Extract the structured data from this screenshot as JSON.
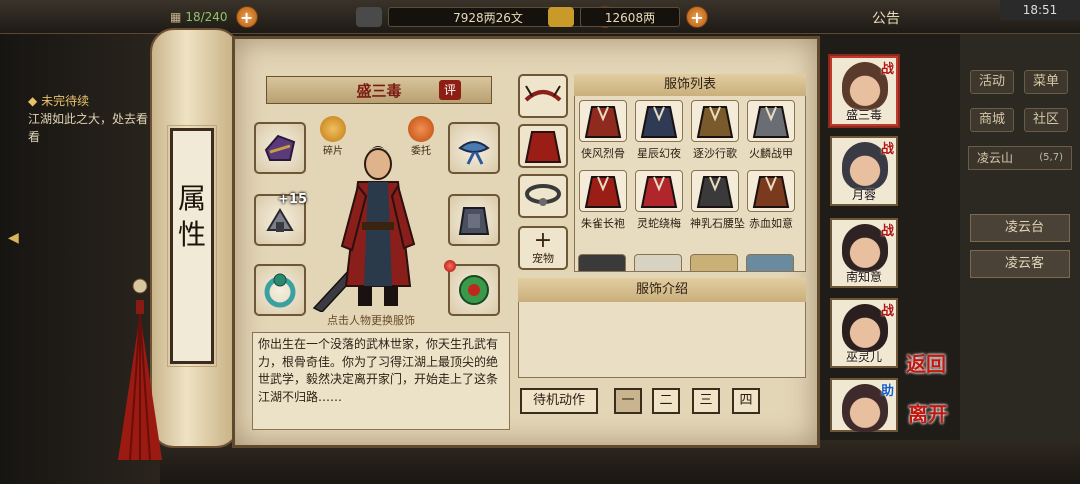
{
  "topbar": {
    "bag": "18/240",
    "silver": "7928两26文",
    "gold": "12608两",
    "notice": "公告",
    "time": "18:51"
  },
  "quest": {
    "title": "未完待续",
    "text": "江湖如此之大，处去看看"
  },
  "right_menu": {
    "activity": "活动",
    "menu": "菜单",
    "shop": "商城",
    "community": "社区",
    "area": "凌云山",
    "coords": "(5,7)",
    "places": [
      "凌云台",
      "凌云客"
    ]
  },
  "scroll": {
    "title": "属性"
  },
  "character": {
    "name": "盛三毒",
    "rate_label": "评",
    "bonus": "+15",
    "fragment_label": "碎片",
    "entrust_label": "委托",
    "hint": "点击人物更换服饰",
    "description": "你出生在一个没落的武林世家，你天生孔武有力，根骨奇佳。你为了习得江湖上最顶尖的绝世武学，毅然决定离开家门，开始走上了这条江湖不归路……"
  },
  "tabs": {
    "pet_label": "宠物"
  },
  "outfit_list": {
    "title": "服饰列表",
    "items": [
      {
        "name": "侠风烈骨",
        "color": "#8e2a1e"
      },
      {
        "name": "星辰幻夜",
        "color": "#2f3b55"
      },
      {
        "name": "逐沙行歌",
        "color": "#7a5a2a"
      },
      {
        "name": "火麟战甲",
        "color": "#6a6e74"
      },
      {
        "name": "朱雀长袍",
        "color": "#9a1e16"
      },
      {
        "name": "灵蛇绕梅",
        "color": "#b0262a"
      },
      {
        "name": "神乳石腰坠",
        "color": "#3a3a3a"
      },
      {
        "name": "赤血如意",
        "color": "#7a3a1e"
      }
    ]
  },
  "outfit_intro": {
    "title": "服饰介绍"
  },
  "idle": {
    "label": "待机动作",
    "options": [
      "一",
      "二",
      "三",
      "四"
    ],
    "selected": 0
  },
  "party": [
    {
      "name": "盛三毒",
      "badge": "战",
      "selected": true,
      "color": "#5a3a2a"
    },
    {
      "name": "月蓉",
      "badge": "战",
      "selected": false,
      "color": "#3a3a44"
    },
    {
      "name": "南知意",
      "badge": "战",
      "selected": false,
      "color": "#2e2222"
    },
    {
      "name": "巫灵儿",
      "badge": "战",
      "selected": false,
      "color": "#2a1e1e"
    },
    {
      "name": "",
      "badge": "助",
      "selected": false,
      "color": "#3e2a2a"
    }
  ],
  "actions": {
    "back": "返回",
    "leave": "离开"
  }
}
